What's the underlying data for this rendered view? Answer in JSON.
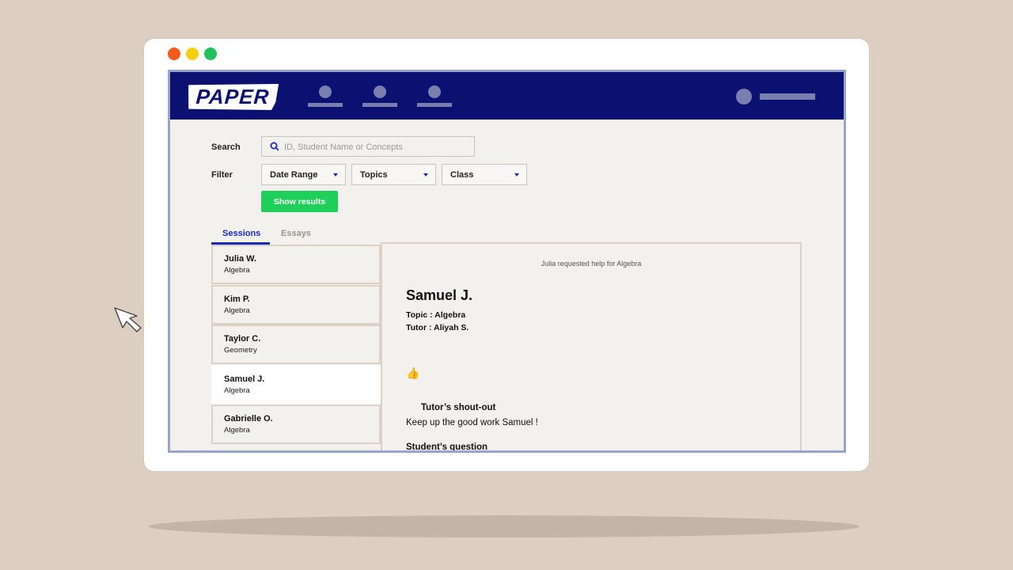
{
  "window": {
    "controls": [
      "close",
      "minimize",
      "maximize"
    ]
  },
  "header": {
    "logo": "PAPER",
    "nav_icons": [
      "nav-icon-1",
      "nav-icon-2",
      "nav-icon-3"
    ],
    "user_icon": "avatar-icon"
  },
  "search": {
    "label": "Search",
    "placeholder": "ID, Student Name or Concepts",
    "value": "",
    "icon": "search-icon"
  },
  "filter": {
    "label": "Filter",
    "date_range": "Date Range",
    "topics": "Topics",
    "class": "Class"
  },
  "show_results_label": "Show results",
  "tabs": {
    "sessions": "Sessions",
    "essays": "Essays",
    "active": "Sessions"
  },
  "sessions": [
    {
      "name": "Julia W.",
      "topic": "Algebra"
    },
    {
      "name": "Kim P.",
      "topic": "Algebra"
    },
    {
      "name": "Taylor C.",
      "topic": "Geometry"
    },
    {
      "name": "Samuel J.",
      "topic": "Algebra"
    },
    {
      "name": "Gabrielle O.",
      "topic": "Algebra"
    }
  ],
  "selected_session_index": 3,
  "detail": {
    "request_note": "Julia requested help for Algebra",
    "student_name": "Samuel J.",
    "topic_line": "Topic : Algebra",
    "tutor_line": "Tutor : Aliyah S.",
    "reaction": "👍",
    "shoutout_heading": "Tutor’s shout-out",
    "shoutout_text": "Keep up the good work Samuel !",
    "question_heading": "Student’s question"
  },
  "colors": {
    "background": "#dccfc2",
    "header": "#0b1170",
    "accent": "#1a2bb8",
    "button": "#1ed05a"
  }
}
